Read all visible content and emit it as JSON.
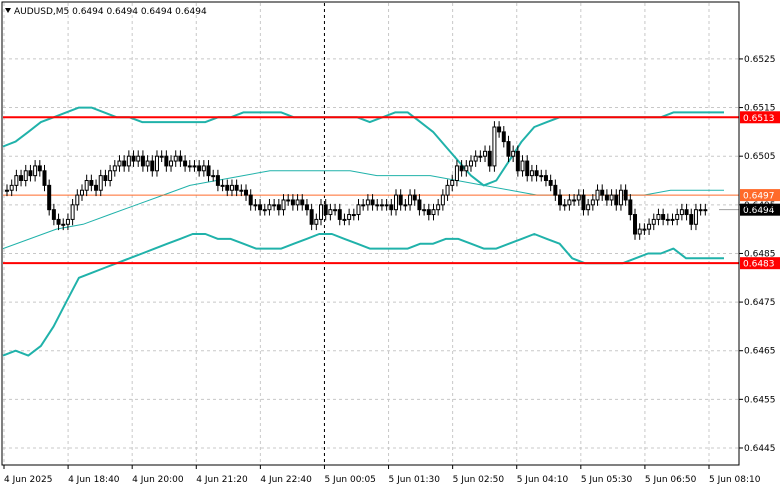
{
  "header": {
    "menu_icon": "triangle-down-icon",
    "title": "AUDUSD,M5  0.6494 0.6494 0.6494 0.6494"
  },
  "colors": {
    "background": "#ffffff",
    "grid": "#c8c8c8",
    "candle": "#000000",
    "bollinger": "#20b2aa",
    "ma": "#20b2aa",
    "level_line": "#ff0000",
    "current_line": "#ff6a2a",
    "separator": "#000000"
  },
  "chart_data": {
    "type": "line",
    "symbol": "AUDUSD",
    "timeframe": "M5",
    "ylim": [
      0.64415,
      0.65365
    ],
    "y_ticks": [
      "0.6525",
      "0.6515",
      "0.6505",
      "0.6495",
      "0.6485",
      "0.6475",
      "0.6465",
      "0.6455",
      "0.6445"
    ],
    "x_ticks": [
      "4 Jun 2025",
      "4 Jun 18:40",
      "4 Jun 20:00",
      "4 Jun 21:20",
      "4 Jun 22:40",
      "5 Jun 00:05",
      "5 Jun 01:30",
      "5 Jun 02:50",
      "5 Jun 04:10",
      "5 Jun 05:30",
      "5 Jun 06:50",
      "5 Jun 08:10"
    ],
    "day_separator_index": 5,
    "grid": true,
    "level_lines": [
      {
        "label": "0.6513",
        "value": 0.6513
      },
      {
        "label": "0.6483",
        "value": 0.6483
      }
    ],
    "current_level": {
      "label": "0.6497",
      "value": 0.6497
    },
    "price_marker": {
      "label": "0.6494",
      "value": 0.6494
    },
    "candles_close": [
      0.6498,
      0.6499,
      0.6501,
      0.65,
      0.6502,
      0.6501,
      0.6503,
      0.6502,
      0.6499,
      0.6494,
      0.6492,
      0.6491,
      0.6491,
      0.6492,
      0.6495,
      0.6497,
      0.6498,
      0.65,
      0.6499,
      0.6498,
      0.6501,
      0.65,
      0.6502,
      0.6503,
      0.6504,
      0.6503,
      0.6505,
      0.6504,
      0.6505,
      0.6503,
      0.6504,
      0.6502,
      0.6505,
      0.6505,
      0.6503,
      0.6504,
      0.6505,
      0.6504,
      0.6503,
      0.6503,
      0.6503,
      0.6502,
      0.6503,
      0.6501,
      0.6501,
      0.6499,
      0.6499,
      0.6498,
      0.6499,
      0.6498,
      0.6498,
      0.6497,
      0.6495,
      0.6495,
      0.6494,
      0.6494,
      0.6495,
      0.6495,
      0.6494,
      0.6496,
      0.6496,
      0.6495,
      0.6496,
      0.6495,
      0.6494,
      0.6491,
      0.6492,
      0.6495,
      0.6493,
      0.6494,
      0.6494,
      0.6492,
      0.6492,
      0.6493,
      0.6493,
      0.6495,
      0.6495,
      0.6496,
      0.6495,
      0.6495,
      0.6495,
      0.6495,
      0.6494,
      0.6497,
      0.6495,
      0.6495,
      0.6497,
      0.6496,
      0.6494,
      0.6494,
      0.6493,
      0.6494,
      0.6495,
      0.6497,
      0.6499,
      0.65,
      0.6503,
      0.6502,
      0.6503,
      0.6504,
      0.6505,
      0.6505,
      0.6506,
      0.6503,
      0.6511,
      0.651,
      0.6508,
      0.6505,
      0.6506,
      0.6502,
      0.6504,
      0.6501,
      0.6502,
      0.6501,
      0.6501,
      0.65,
      0.6499,
      0.6497,
      0.6495,
      0.6495,
      0.6496,
      0.6496,
      0.6497,
      0.6494,
      0.6495,
      0.6496,
      0.6498,
      0.6497,
      0.6496,
      0.6497,
      0.6495,
      0.6498,
      0.6496,
      0.6493,
      0.6489,
      0.649,
      0.649,
      0.6491,
      0.6492,
      0.6493,
      0.6492,
      0.6492,
      0.6492,
      0.6493,
      0.6494,
      0.6493,
      0.6491,
      0.6494,
      0.6494,
      0.6494
    ],
    "bollinger_upper": [
      0.6507,
      0.6508,
      0.651,
      0.6512,
      0.6513,
      0.6514,
      0.6515,
      0.6515,
      0.6514,
      0.6513,
      0.6513,
      0.6512,
      0.6512,
      0.6512,
      0.6512,
      0.6512,
      0.6512,
      0.6513,
      0.6513,
      0.6514,
      0.6514,
      0.6514,
      0.6514,
      0.6513,
      0.6513,
      0.6513,
      0.6513,
      0.6513,
      0.6513,
      0.6512,
      0.6513,
      0.6514,
      0.6514,
      0.6512,
      0.651,
      0.6507,
      0.6504,
      0.6501,
      0.6499,
      0.65,
      0.6504,
      0.6508,
      0.6511,
      0.6512,
      0.6513,
      0.6513,
      0.6513,
      0.6513,
      0.6513,
      0.6513,
      0.6513,
      0.6513,
      0.6513,
      0.6514,
      0.6514,
      0.6514,
      0.6514,
      0.6514
    ],
    "bollinger_lower": [
      0.6464,
      0.6465,
      0.6464,
      0.6466,
      0.647,
      0.6475,
      0.648,
      0.6481,
      0.6482,
      0.6483,
      0.6484,
      0.6485,
      0.6486,
      0.6487,
      0.6488,
      0.6489,
      0.6489,
      0.6488,
      0.6488,
      0.6487,
      0.6486,
      0.6486,
      0.6486,
      0.6487,
      0.6488,
      0.6489,
      0.6489,
      0.6488,
      0.6487,
      0.6486,
      0.6486,
      0.6486,
      0.6486,
      0.6487,
      0.6487,
      0.6488,
      0.6488,
      0.6487,
      0.6486,
      0.6486,
      0.6487,
      0.6488,
      0.6489,
      0.6488,
      0.6487,
      0.6484,
      0.6483,
      0.6483,
      0.6483,
      0.6483,
      0.6484,
      0.6485,
      0.6485,
      0.6486,
      0.6484,
      0.6484,
      0.6484,
      0.6484
    ],
    "moving_average": [
      0.6486,
      0.6488,
      0.649,
      0.6491,
      0.6493,
      0.6495,
      0.6497,
      0.6499,
      0.65,
      0.6501,
      0.6502,
      0.6502,
      0.6502,
      0.6502,
      0.6501,
      0.6501,
      0.6501,
      0.65,
      0.6499,
      0.6498,
      0.6497,
      0.6497,
      0.6497,
      0.6497,
      0.6497,
      0.6498,
      0.6498,
      0.6498
    ]
  }
}
